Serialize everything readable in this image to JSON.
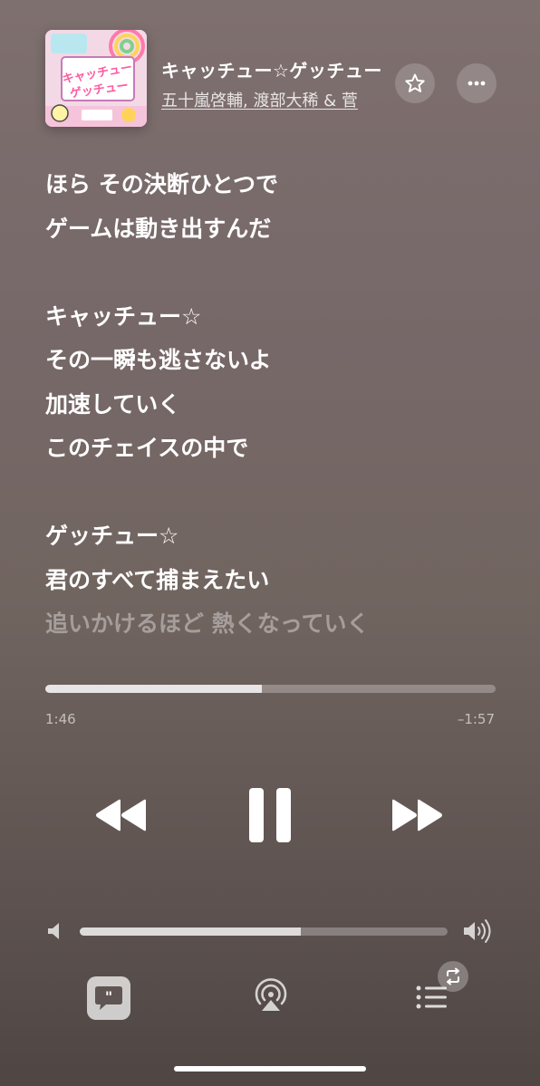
{
  "now_playing": {
    "title": "キャッチュー☆ゲッチュー",
    "artists": "五十嵐啓輔, 渡部大稀 & 菅",
    "artwork_text": "キャッチュー ゲッチュー"
  },
  "lyrics": {
    "lines": [
      "ほら その決断ひとつで",
      "ゲームは動き出すんだ",
      "",
      "キャッチュー☆",
      "その一瞬も逃さないよ",
      "加速していく",
      "このチェイスの中で",
      "",
      "ゲッチュー☆",
      "君のすべて捕まえたい",
      "追いかけるほど 熱くなっていく"
    ],
    "dim_from_index": 10
  },
  "playback": {
    "elapsed": "1:46",
    "remaining": "–1:57",
    "progress_fraction": 0.48,
    "state": "playing"
  },
  "volume": {
    "level_fraction": 0.6
  },
  "icons": {
    "favorite": "star-icon",
    "more": "ellipsis-icon",
    "rewind": "rewind-icon",
    "pause": "pause-icon",
    "forward": "fast-forward-icon",
    "volume_low": "speaker-low-icon",
    "volume_high": "speaker-high-icon",
    "lyrics": "quote-bubble-icon",
    "airplay": "airplay-icon",
    "queue": "list-icon",
    "repeat": "repeat-icon"
  }
}
